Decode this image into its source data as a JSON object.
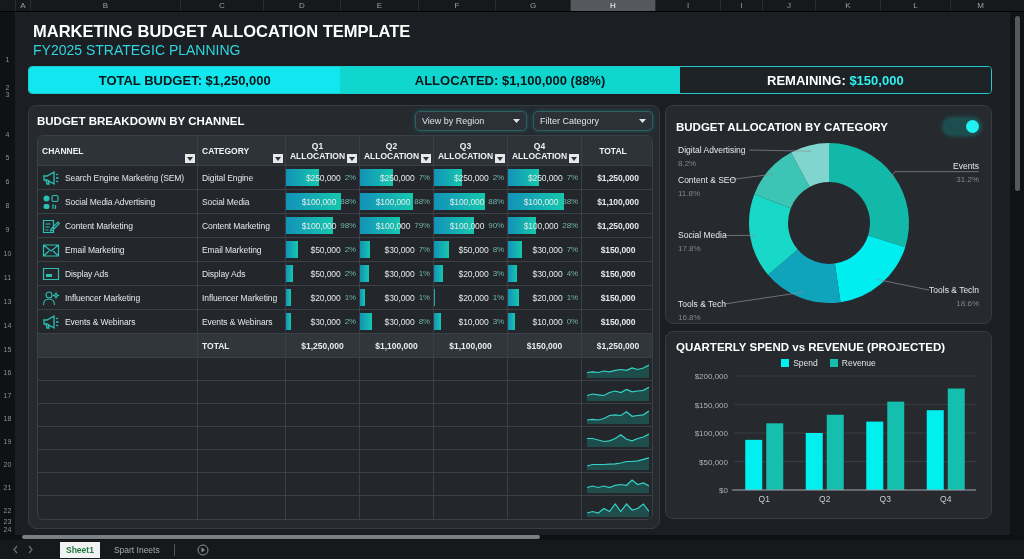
{
  "column_headers": [
    {
      "label": "A",
      "selected": false
    },
    {
      "label": "B",
      "selected": false
    },
    {
      "label": "C",
      "selected": false
    },
    {
      "label": "D",
      "selected": false
    },
    {
      "label": "E",
      "selected": false
    },
    {
      "label": "F",
      "selected": false
    },
    {
      "label": "G",
      "selected": false
    },
    {
      "label": "H",
      "selected": true
    },
    {
      "label": "I",
      "selected": false
    },
    {
      "label": "I",
      "selected": false
    },
    {
      "label": "J",
      "selected": false
    },
    {
      "label": "K",
      "selected": false
    },
    {
      "label": "L",
      "selected": false
    },
    {
      "label": "M",
      "selected": false
    }
  ],
  "row_headers": [
    "1",
    "2",
    "3",
    "4",
    "5",
    "6",
    "8",
    "9",
    "10",
    "11",
    "13",
    "14",
    "15",
    "16",
    "17",
    "18",
    "19",
    "20",
    "21",
    "22",
    "23",
    "24"
  ],
  "title": "MARKETING BUDGET ALLOCATION TEMPLATE",
  "subtitle": "FY2025 STRATEGIC PLANNING",
  "summary": [
    {
      "kind": "total",
      "label": "TOTAL BUDGET:",
      "value": "$1,250,000"
    },
    {
      "kind": "allocated",
      "label": "ALLOCATED:",
      "value": "$1,100,000 (88%)"
    },
    {
      "kind": "remaining",
      "label": "REMAINING:",
      "value": "$150,000"
    }
  ],
  "breakdown": {
    "title": "BUDGET BREAKDOWN BY CHANNEL",
    "dropdowns": [
      {
        "value": "View by Region"
      },
      {
        "value": "Filter Category"
      }
    ],
    "table": {
      "columns": [
        {
          "label": "CHANNEL",
          "filter": true
        },
        {
          "label": "CATEGORY",
          "filter": true
        },
        {
          "label": "Q1 ALLOCATION",
          "filter": true
        },
        {
          "label": "Q2 ALLOCATION",
          "filter": true
        },
        {
          "label": "Q3 ALLOCATION",
          "filter": true
        },
        {
          "label": "Q4 ALLOCATION",
          "filter": true
        },
        {
          "label": "TOTAL",
          "filter": false
        }
      ],
      "rows": [
        {
          "channel": "Search Engine Marketing (SEM)",
          "category": "Digital Engine",
          "quarters": [
            {
              "amount": "$250,000",
              "share": "2%",
              "level": 0.45
            },
            {
              "amount": "$250,000",
              "share": "7%",
              "level": 0.45
            },
            {
              "amount": "$250,000",
              "share": "2%",
              "level": 0.38
            },
            {
              "amount": "$250,000",
              "share": "7%",
              "level": 0.42
            }
          ],
          "total": "$1,250,000"
        },
        {
          "channel": "Social Media Advertising",
          "category": "Social Media",
          "quarters": [
            {
              "amount": "$100,000",
              "share": "88%",
              "level": 0.75
            },
            {
              "amount": "$100,000",
              "share": "88%",
              "level": 0.72
            },
            {
              "amount": "$100,000",
              "share": "88%",
              "level": 0.7
            },
            {
              "amount": "$100,000",
              "share": "88%",
              "level": 0.77
            }
          ],
          "total": "$1,100,000"
        },
        {
          "channel": "Content Marketing",
          "category": "Content Marketing",
          "quarters": [
            {
              "amount": "$100,000",
              "share": "98%",
              "level": 0.65
            },
            {
              "amount": "$100,000",
              "share": "79%",
              "level": 0.55
            },
            {
              "amount": "$100,000",
              "share": "90%",
              "level": 0.55
            },
            {
              "amount": "$100,000",
              "share": "28%",
              "level": 0.38
            }
          ],
          "total": "$1,250,000"
        },
        {
          "channel": "Email Marketing",
          "category": "Email Marketing",
          "quarters": [
            {
              "amount": "$50,000",
              "share": "2%",
              "level": 0.17
            },
            {
              "amount": "$30,000",
              "share": "7%",
              "level": 0.14
            },
            {
              "amount": "$50,000",
              "share": "8%",
              "level": 0.2
            },
            {
              "amount": "$30,000",
              "share": "7%",
              "level": 0.19
            }
          ],
          "total": "$150,000"
        },
        {
          "channel": "Display Ads",
          "category": "Display Ads",
          "quarters": [
            {
              "amount": "$50,000",
              "share": "2%",
              "level": 0.1
            },
            {
              "amount": "$30,000",
              "share": "1%",
              "level": 0.12
            },
            {
              "amount": "$20,000",
              "share": "3%",
              "level": 0.12
            },
            {
              "amount": "$30,000",
              "share": "4%",
              "level": 0.12
            }
          ],
          "total": "$150,000"
        },
        {
          "channel": "Influencer Marketing",
          "category": "Influencer Marketing",
          "quarters": [
            {
              "amount": "$20,000",
              "share": "1%",
              "level": 0.07
            },
            {
              "amount": "$30,000",
              "share": "1%",
              "level": 0.07
            },
            {
              "amount": "$20,000",
              "share": "1%",
              "level": 0.02
            },
            {
              "amount": "$20,000",
              "share": "1%",
              "level": 0.15
            }
          ],
          "total": "$150,000"
        },
        {
          "channel": "Events & Webinars",
          "category": "Events & Webinars",
          "quarters": [
            {
              "amount": "$30,000",
              "share": "2%",
              "level": 0.07
            },
            {
              "amount": "$30,000",
              "share": "8%",
              "level": 0.17
            },
            {
              "amount": "$10,000",
              "share": "3%",
              "level": 0.1
            },
            {
              "amount": "$10,000",
              "share": "0%",
              "level": 0.1
            }
          ],
          "total": "$150,000"
        }
      ],
      "totals": {
        "label": "TOTAL",
        "quarters": [
          "$1,250,000",
          "$1,100,000",
          "$1,100,000",
          "$150,000"
        ],
        "total": "$1,250,000"
      }
    }
  },
  "category_panel": {
    "toggle": {
      "on": true
    },
    "chart_data": {
      "type": "donut",
      "title": "BUDGET ALLOCATION BY CATEGORY",
      "categories": [
        "Events",
        "Tools & Tecln",
        "Tools & Tech",
        "Social Media",
        "Content & SEO",
        "Digital Advertising"
      ],
      "values": [
        31.2,
        18.6,
        16.8,
        17.8,
        11.8,
        8.2
      ],
      "value_labels": [
        "31.2%",
        "18.6%",
        "16.8%",
        "17.8%",
        "11.8%",
        "8.2%"
      ]
    }
  },
  "quarterly_panel": {
    "chart_data": {
      "type": "bar",
      "title": "QUARTERLY SPEND vs REVENUE (PROJECTED)",
      "categories": [
        "Q1",
        "Q2",
        "Q3",
        "Q4"
      ],
      "series": [
        {
          "name": "Spend",
          "color": "#00f0f0",
          "values": [
            88000,
            100000,
            120000,
            140000
          ]
        },
        {
          "name": "Revenue",
          "color": "#14bfae",
          "values": [
            117000,
            132000,
            155000,
            178000
          ]
        }
      ],
      "ylim": [
        0,
        200000
      ],
      "grid": true,
      "yticks": [
        {
          "value": 0,
          "label": "$0"
        },
        {
          "value": 50000,
          "label": "$50,000"
        },
        {
          "value": 100000,
          "label": "$100,000"
        },
        {
          "value": 150000,
          "label": "$150,000"
        },
        {
          "value": 200000,
          "label": "$200,000"
        }
      ]
    }
  },
  "sheet_tabs": [
    {
      "label": "Sheet1",
      "selected": true
    },
    {
      "label": "Spart Ineets",
      "selected": false
    }
  ]
}
